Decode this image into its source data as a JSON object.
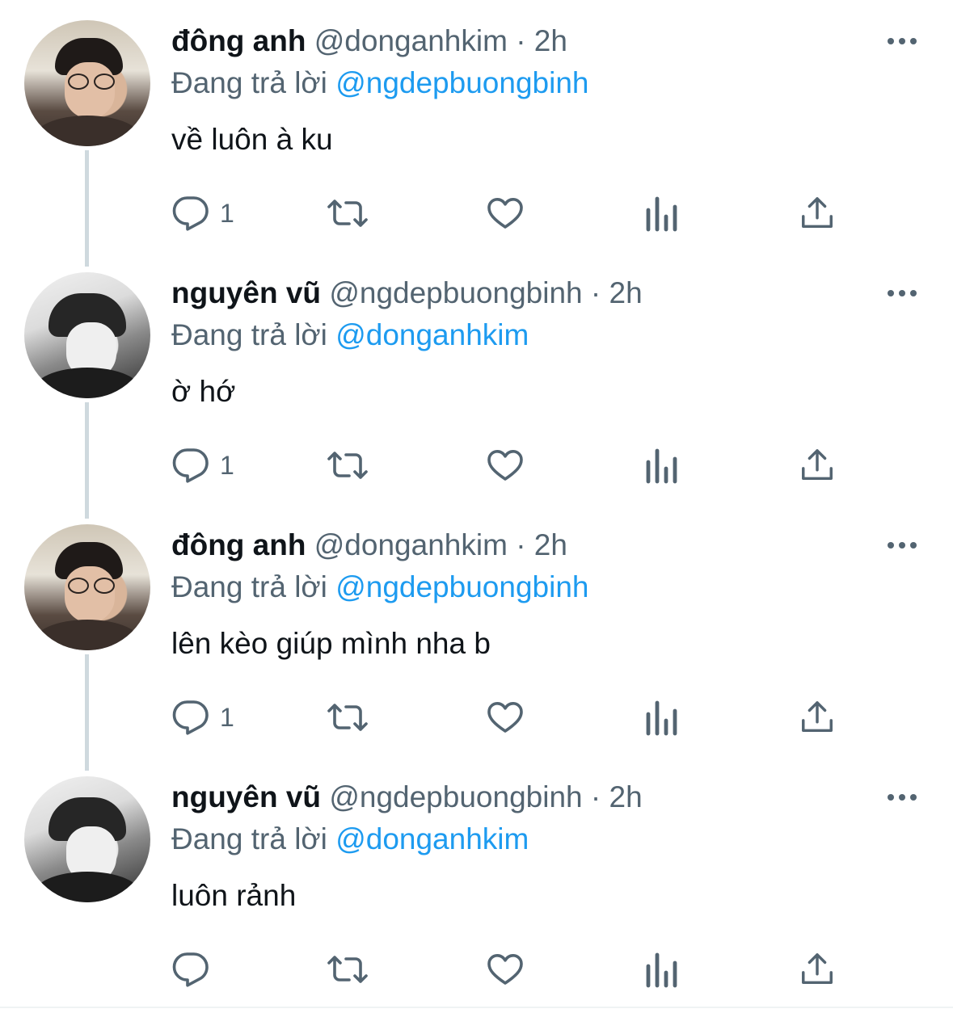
{
  "colors": {
    "primary_text": "#0f1419",
    "secondary_text": "#536471",
    "mention": "#1d9bf0",
    "thread_line": "#cfd9de"
  },
  "reply_prefix": "Đang trả lời",
  "tweets": [
    {
      "name": "đông anh",
      "handle": "@donganhkim",
      "separator": "·",
      "time": "2h",
      "reply_to": "@ngdepbuongbinh",
      "text": "về luôn à ku",
      "reply_count": "1",
      "avatar": "color-portrait"
    },
    {
      "name": "nguyên vũ",
      "handle": "@ngdepbuongbinh",
      "separator": "·",
      "time": "2h",
      "reply_to": "@donganhkim",
      "text": "ờ hớ",
      "reply_count": "1",
      "avatar": "monochrome-portrait"
    },
    {
      "name": "đông anh",
      "handle": "@donganhkim",
      "separator": "·",
      "time": "2h",
      "reply_to": "@ngdepbuongbinh",
      "text": "lên kèo giúp mình nha b",
      "reply_count": "1",
      "avatar": "color-portrait"
    },
    {
      "name": "nguyên vũ",
      "handle": "@ngdepbuongbinh",
      "separator": "·",
      "time": "2h",
      "reply_to": "@donganhkim",
      "text": "luôn rảnh",
      "reply_count": "",
      "avatar": "monochrome-portrait"
    }
  ],
  "icons": [
    "reply-icon",
    "retweet-icon",
    "like-icon",
    "views-icon",
    "share-icon",
    "more-icon"
  ]
}
